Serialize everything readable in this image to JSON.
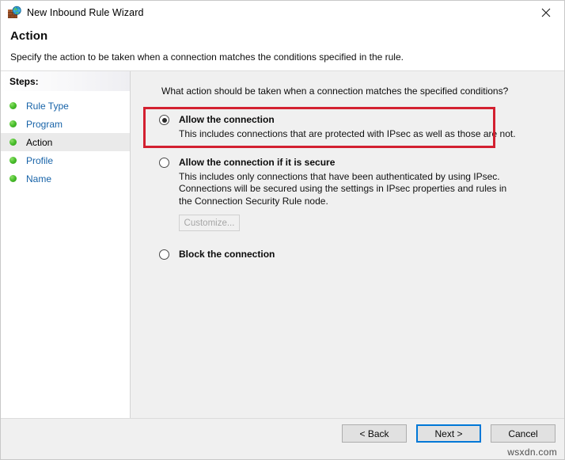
{
  "window": {
    "title": "New Inbound Rule Wizard",
    "icon": "firewall-globe-icon",
    "close_label": "✕"
  },
  "header": {
    "title": "Action",
    "subtitle": "Specify the action to be taken when a connection matches the conditions specified in the rule."
  },
  "sidebar": {
    "heading": "Steps:",
    "items": [
      {
        "label": "Rule Type",
        "current": false
      },
      {
        "label": "Program",
        "current": false
      },
      {
        "label": "Action",
        "current": true
      },
      {
        "label": "Profile",
        "current": false
      },
      {
        "label": "Name",
        "current": false
      }
    ]
  },
  "main": {
    "question": "What action should be taken when a connection matches the specified conditions?",
    "options": [
      {
        "title": "Allow the connection",
        "description": "This includes connections that are protected with IPsec as well as those are not.",
        "selected": true,
        "highlighted": true
      },
      {
        "title": "Allow the connection if it is secure",
        "description": "This includes only connections that have been authenticated by using IPsec.  Connections will be secured using the settings in IPsec properties and rules in the Connection Security Rule node.",
        "selected": false,
        "highlighted": false,
        "button": {
          "label": "Customize...",
          "disabled": true
        }
      },
      {
        "title": "Block the connection",
        "description": "",
        "selected": false,
        "highlighted": false
      }
    ]
  },
  "footer": {
    "back_label": "< Back",
    "next_label": "Next >",
    "cancel_label": "Cancel"
  },
  "watermark": {
    "text": "wsxdn.com"
  },
  "colors": {
    "highlight_red": "#d32030",
    "link_blue": "#1763a8",
    "focus_blue": "#0078d7",
    "bullet_green": "#49bf2c",
    "content_bg": "#f0f0f0"
  }
}
